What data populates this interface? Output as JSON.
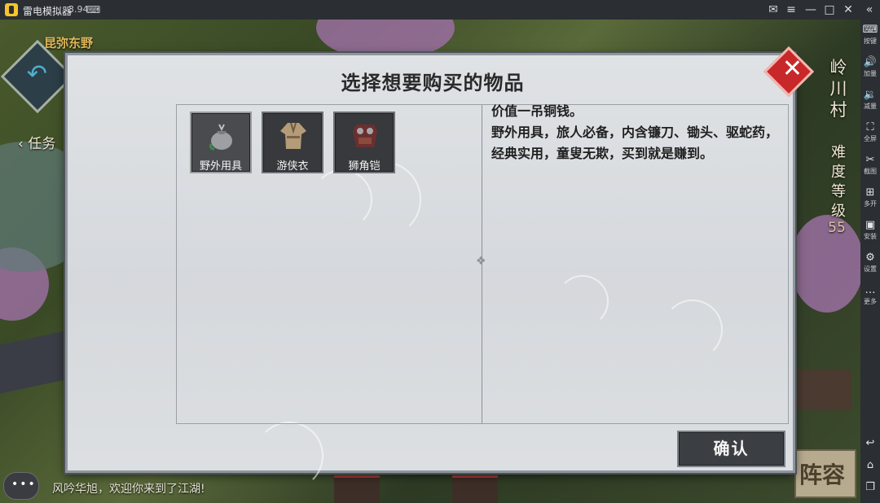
{
  "emulator": {
    "title": "雷电模拟器",
    "version": "3.94",
    "sidebar": [
      {
        "label": "按键",
        "icon": "keyboard-icon"
      },
      {
        "label": "加量",
        "icon": "volume-up-icon"
      },
      {
        "label": "减量",
        "icon": "volume-down-icon"
      },
      {
        "label": "全屏",
        "icon": "fullscreen-icon"
      },
      {
        "label": "截图",
        "icon": "scissors-icon"
      },
      {
        "label": "多开",
        "icon": "multi-instance-icon"
      },
      {
        "label": "安装",
        "icon": "apk-install-icon"
      },
      {
        "label": "设置",
        "icon": "gear-icon"
      },
      {
        "label": "更多",
        "icon": "more-icon"
      }
    ]
  },
  "game": {
    "location": "昆弥东野",
    "task_tab": "任务",
    "village": "岭川村",
    "difficulty_label": "难度等级",
    "difficulty_value": "55",
    "chat_message": "风吟华旭，欢迎你来到了江湖!",
    "formation_button": "阵容"
  },
  "dialog": {
    "title": "选择想要购买的物品",
    "items": [
      {
        "name": "野外用具",
        "icon": "bag-icon",
        "selected": true
      },
      {
        "name": "游侠衣",
        "icon": "robe-icon",
        "selected": false
      },
      {
        "name": "狮角铠",
        "icon": "armor-icon",
        "selected": false
      }
    ],
    "description": {
      "price": "价值一吊铜钱。",
      "text": "野外用具，旅人必备，内含镰刀、锄头、驱蛇药，经典实用，童叟无欺，买到就是赚到。"
    },
    "confirm_button": "确认"
  }
}
